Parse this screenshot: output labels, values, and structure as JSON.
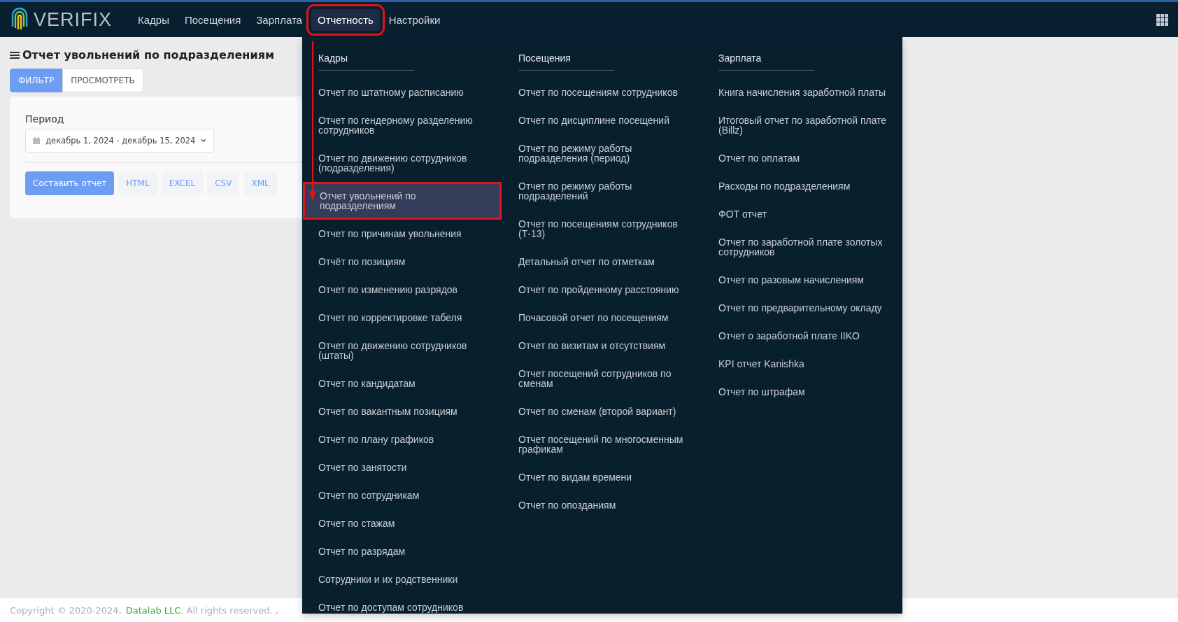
{
  "header": {
    "logo": "VERIFIX",
    "nav": [
      {
        "label": "Кадры",
        "selected": false
      },
      {
        "label": "Посещения",
        "selected": false
      },
      {
        "label": "Зарплата",
        "selected": false
      },
      {
        "label": "Отчетность",
        "selected": true
      },
      {
        "label": "Настройки",
        "selected": false
      }
    ]
  },
  "page": {
    "title": "Отчет увольнений по подразделениям",
    "tabs": [
      {
        "label": "ФИЛЬТР",
        "selected": true
      },
      {
        "label": "ПРОСМОТРЕТЬ",
        "selected": false
      }
    ],
    "period": {
      "label": "Период",
      "value": "декабрь 1, 2024 - декабрь 15, 2024"
    },
    "buttons": [
      {
        "label": "Составить отчет",
        "kind": "primary"
      },
      {
        "label": "HTML",
        "kind": "export"
      },
      {
        "label": "EXCEL",
        "kind": "export"
      },
      {
        "label": "CSV",
        "kind": "export"
      },
      {
        "label": "XML",
        "kind": "export"
      }
    ]
  },
  "menu": {
    "columns": [
      {
        "title": "Кадры",
        "items": [
          {
            "label": "Отчет по штатному расписанию",
            "selected": false
          },
          {
            "label": "Отчет по гендерному разделению сотрудников",
            "selected": false
          },
          {
            "label": "Отчет по движению сотрудников (подразделения)",
            "selected": false
          },
          {
            "label": "Отчет увольнений по подразделениям",
            "selected": true
          },
          {
            "label": "Отчет по причинам увольнения",
            "selected": false
          },
          {
            "label": "Отчёт по позициям",
            "selected": false
          },
          {
            "label": "Отчет по изменению разрядов",
            "selected": false
          },
          {
            "label": "Отчет по корректировке табеля",
            "selected": false
          },
          {
            "label": "Отчет по движению сотрудников (штаты)",
            "selected": false
          },
          {
            "label": "Отчет по кандидатам",
            "selected": false
          },
          {
            "label": "Отчет по вакантным позициям",
            "selected": false
          },
          {
            "label": "Отчет по плану графиков",
            "selected": false
          },
          {
            "label": "Отчет по занятости",
            "selected": false
          },
          {
            "label": "Отчет по сотрудникам",
            "selected": false
          },
          {
            "label": "Отчет по стажам",
            "selected": false
          },
          {
            "label": "Отчет по разрядам",
            "selected": false
          },
          {
            "label": "Сотрудники и их родственники",
            "selected": false
          },
          {
            "label": "Отчет по доступам сотрудников",
            "selected": false
          }
        ]
      },
      {
        "title": "Посещения",
        "items": [
          {
            "label": "Отчет по посещениям сотрудников",
            "selected": false
          },
          {
            "label": "Отчет по дисциплине посещений",
            "selected": false
          },
          {
            "label": "Отчет по режиму работы подразделения (период)",
            "selected": false
          },
          {
            "label": "Отчет по режиму работы подразделений",
            "selected": false
          },
          {
            "label": "Отчет по посещениям сотрудников (Т-13)",
            "selected": false
          },
          {
            "label": "Детальный отчет по отметкам",
            "selected": false
          },
          {
            "label": "Отчет по пройденному расстоянию",
            "selected": false
          },
          {
            "label": "Почасовой отчет по посещениям",
            "selected": false
          },
          {
            "label": "Отчет по визитам и отсутствиям",
            "selected": false
          },
          {
            "label": "Отчет посещений сотрудников по сменам",
            "selected": false
          },
          {
            "label": "Отчет по сменам (второй вариант)",
            "selected": false
          },
          {
            "label": "Отчет посещений по многосменным графикам",
            "selected": false
          },
          {
            "label": "Отчет по видам времени",
            "selected": false
          },
          {
            "label": "Отчет по опозданиям",
            "selected": false
          }
        ]
      },
      {
        "title": "Зарплата",
        "items": [
          {
            "label": "Книга начисления заработной платы",
            "selected": false
          },
          {
            "label": "Итоговый отчет по заработной плате (Billz)",
            "selected": false
          },
          {
            "label": "Отчет по оплатам",
            "selected": false
          },
          {
            "label": "Расходы по подразделениям",
            "selected": false
          },
          {
            "label": "ФОТ отчет",
            "selected": false
          },
          {
            "label": "Отчет по заработной плате золотых сотрудников",
            "selected": false
          },
          {
            "label": "Отчет по разовым начислениям",
            "selected": false
          },
          {
            "label": "Отчет по предварительному окладу",
            "selected": false
          },
          {
            "label": "Отчет о заработной плате IIKO",
            "selected": false
          },
          {
            "label": "KPI отчет Kanishka",
            "selected": false
          },
          {
            "label": "Отчет по штрафам",
            "selected": false
          }
        ]
      }
    ]
  },
  "footer": {
    "text": "Copyright © 2020-2024,",
    "link": "Datalab LLC",
    "suffix": ". All rights reserved. ,"
  }
}
